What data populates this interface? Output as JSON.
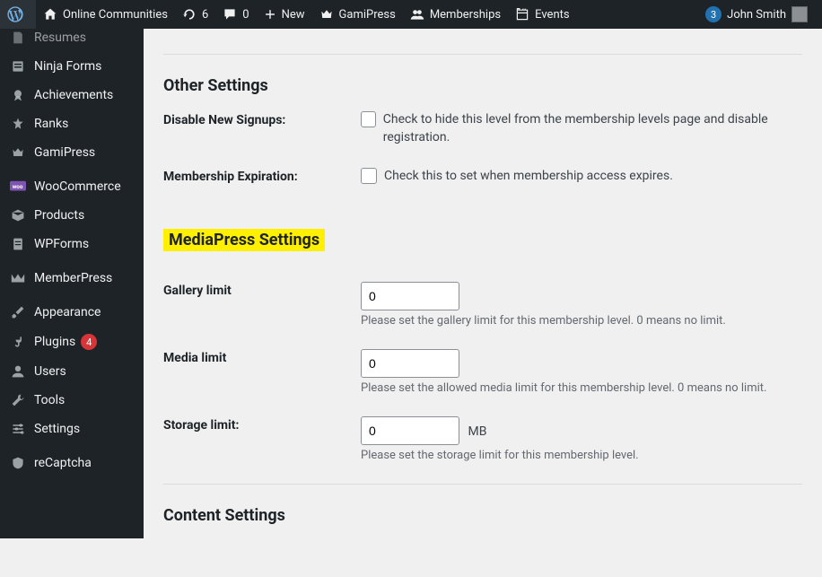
{
  "adminbar": {
    "site": "Online Communities",
    "updates": "6",
    "comments": "0",
    "new": "New",
    "gamipress": "GamiPress",
    "memberships": "Memberships",
    "events": "Events",
    "notif_count": "3",
    "user": "John Smith"
  },
  "sidebar": {
    "items": [
      {
        "label": "Resumes"
      },
      {
        "label": "Ninja Forms"
      },
      {
        "label": "Achievements"
      },
      {
        "label": "Ranks"
      },
      {
        "label": "GamiPress"
      },
      {
        "label": "WooCommerce"
      },
      {
        "label": "Products"
      },
      {
        "label": "WPForms"
      },
      {
        "label": "MemberPress"
      },
      {
        "label": "Appearance"
      },
      {
        "label": "Plugins",
        "badge": "4"
      },
      {
        "label": "Users"
      },
      {
        "label": "Tools"
      },
      {
        "label": "Settings"
      },
      {
        "label": "reCaptcha"
      }
    ]
  },
  "sections": {
    "other": "Other Settings",
    "mediapress": "MediaPress Settings",
    "content": "Content Settings"
  },
  "fields": {
    "disable_signups": {
      "label": "Disable New Signups:",
      "desc": "Check to hide this level from the membership levels page and disable registration."
    },
    "expiration": {
      "label": "Membership Expiration:",
      "desc": "Check this to set when membership access expires."
    },
    "gallery_limit": {
      "label": "Gallery limit",
      "value": "0",
      "help": "Please set the gallery limit for this membership level. 0 means no limit."
    },
    "media_limit": {
      "label": "Media limit",
      "value": "0",
      "help": "Please set the allowed media limit for this membership level. 0 means no limit."
    },
    "storage_limit": {
      "label": "Storage limit:",
      "value": "0",
      "unit": "MB",
      "help": "Please set the storage limit for this membership level."
    }
  }
}
